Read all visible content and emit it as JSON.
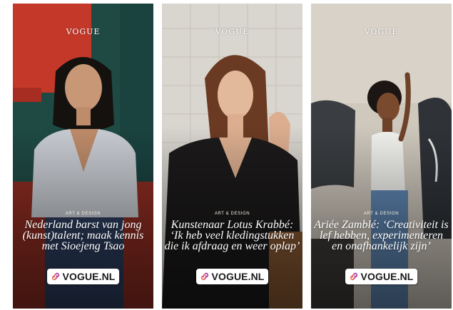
{
  "stories": [
    {
      "masthead": "VOGUE",
      "category": "ART & DESIGN",
      "headline": [
        "Nederland barst van jong",
        "(kunst)talent; maak kennis",
        "met Sioejeng Tsao"
      ],
      "link_label": "VOGUE.NL",
      "link_icon": "link-icon"
    },
    {
      "masthead": "VOGUE",
      "category": "ART & DESIGN",
      "headline": [
        "Kunstenaar Lotus Krabbé:",
        "‘Ik heb veel kledingstukken",
        "die ik afdraag en weer oplap’"
      ],
      "link_label": "VOGUE.NL",
      "link_icon": "link-icon"
    },
    {
      "masthead": "VOGUE",
      "category": "ART & DESIGN",
      "headline": [
        "Ariée Zamblé: ‘Creativiteit is",
        "lef hebben, experimenteren",
        "en onafhankelijk zijn’"
      ],
      "link_label": "VOGUE.NL",
      "link_icon": "link-icon"
    }
  ],
  "colors": {
    "link_icon_gradient": [
      "#f58529",
      "#dd2a7b",
      "#8134af"
    ]
  }
}
